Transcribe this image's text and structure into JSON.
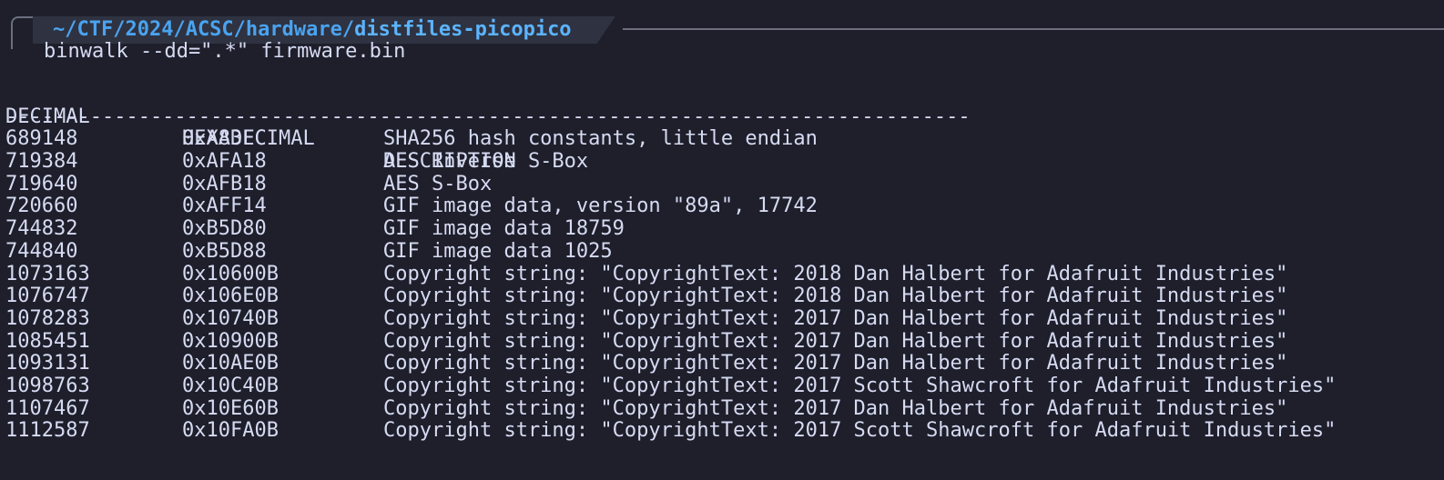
{
  "prompt": {
    "path_prefix": "~/CTF/2024/ACSC/hardware/",
    "path_current": "distfiles-picopico",
    "command": "binwalk --dd=\".*\" firmware.bin"
  },
  "table": {
    "headers": {
      "decimal": "DECIMAL",
      "hexadecimal": "HEXADECIMAL",
      "description": "DESCRIPTION"
    },
    "separator": "--------------------------------------------------------------------------------",
    "rows": [
      {
        "decimal": "689148",
        "hex": "0xA83FC",
        "desc": "SHA256 hash constants, little endian"
      },
      {
        "decimal": "719384",
        "hex": "0xAFA18",
        "desc": "AES Inverse S-Box"
      },
      {
        "decimal": "719640",
        "hex": "0xAFB18",
        "desc": "AES S-Box"
      },
      {
        "decimal": "720660",
        "hex": "0xAFF14",
        "desc": "GIF image data, version \"89a\", 17742"
      },
      {
        "decimal": "744832",
        "hex": "0xB5D80",
        "desc": "GIF image data 18759"
      },
      {
        "decimal": "744840",
        "hex": "0xB5D88",
        "desc": "GIF image data 1025"
      },
      {
        "decimal": "1073163",
        "hex": "0x10600B",
        "desc": "Copyright string: \"CopyrightText: 2018 Dan Halbert for Adafruit Industries\""
      },
      {
        "decimal": "1076747",
        "hex": "0x106E0B",
        "desc": "Copyright string: \"CopyrightText: 2018 Dan Halbert for Adafruit Industries\""
      },
      {
        "decimal": "1078283",
        "hex": "0x10740B",
        "desc": "Copyright string: \"CopyrightText: 2017 Dan Halbert for Adafruit Industries\""
      },
      {
        "decimal": "1085451",
        "hex": "0x10900B",
        "desc": "Copyright string: \"CopyrightText: 2017 Dan Halbert for Adafruit Industries\""
      },
      {
        "decimal": "1093131",
        "hex": "0x10AE0B",
        "desc": "Copyright string: \"CopyrightText: 2017 Dan Halbert for Adafruit Industries\""
      },
      {
        "decimal": "1098763",
        "hex": "0x10C40B",
        "desc": "Copyright string: \"CopyrightText: 2017 Scott Shawcroft for Adafruit Industries\""
      },
      {
        "decimal": "1107467",
        "hex": "0x10E60B",
        "desc": "Copyright string: \"CopyrightText: 2017 Dan Halbert for Adafruit Industries\""
      },
      {
        "decimal": "1112587",
        "hex": "0x10FA0B",
        "desc": "Copyright string: \"CopyrightText: 2017 Scott Shawcroft for Adafruit Industries\""
      }
    ]
  }
}
